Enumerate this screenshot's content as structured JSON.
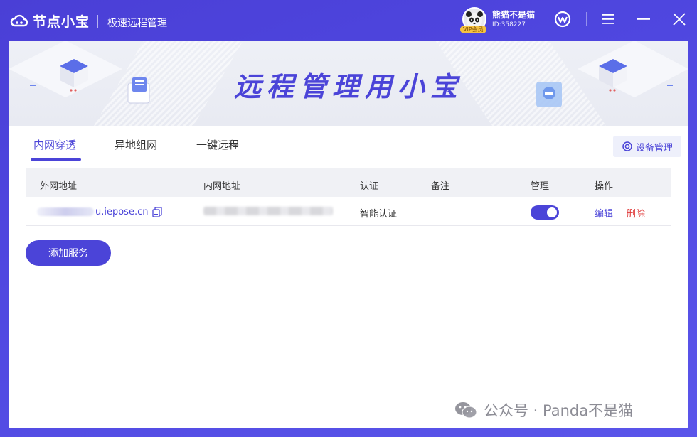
{
  "app": {
    "logo_text": "节点小宝",
    "subtitle": "极速远程管理"
  },
  "user": {
    "name": "熊猫不是猫",
    "id": "ID:358227",
    "vip_label": "VIP会员"
  },
  "banner": {
    "title": "远程管理用小宝"
  },
  "tabs": [
    {
      "label": "内网穿透",
      "active": true
    },
    {
      "label": "异地组网",
      "active": false
    },
    {
      "label": "一键远程",
      "active": false
    }
  ],
  "device_button": {
    "label": "设备管理"
  },
  "table": {
    "headers": [
      "外网地址",
      "内网地址",
      "认证",
      "备注",
      "管理",
      "操作"
    ],
    "rows": [
      {
        "external_suffix": "u.iepose.cn",
        "auth": "智能认证",
        "note": "",
        "enabled": true,
        "edit_label": "编辑",
        "delete_label": "删除"
      }
    ]
  },
  "add_button": {
    "label": "添加服务"
  },
  "watermark": {
    "text": "公众号 · Panda不是猫"
  },
  "colors": {
    "accent": "#4b44d8",
    "danger": "#e03a3a",
    "title_bg": "#4a3fd6"
  }
}
